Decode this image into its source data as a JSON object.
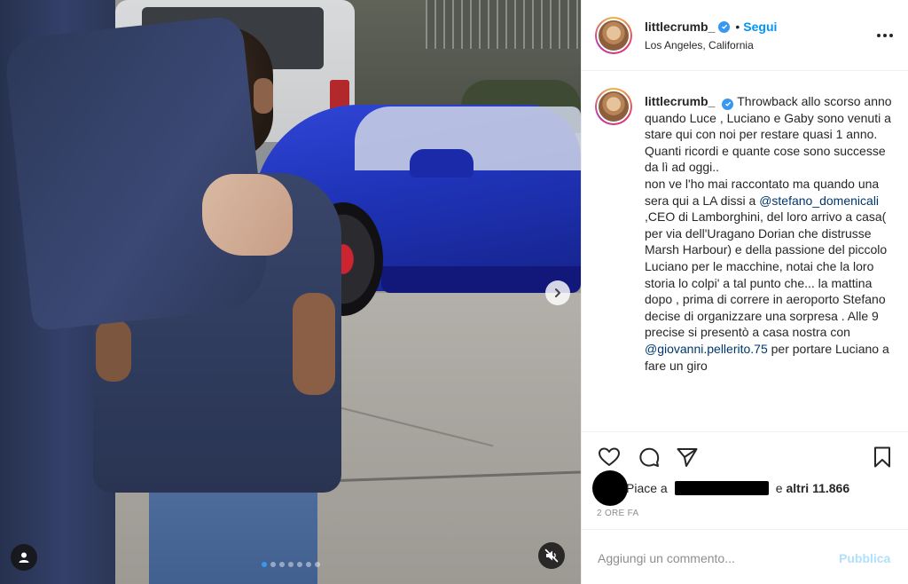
{
  "post": {
    "username": "littlecrumb_",
    "follow_label": "Segui",
    "separator": "•",
    "location": "Los Angeles, California",
    "caption": {
      "username": "littlecrumb_",
      "text_1": "Throwback allo scorso anno quando Luce , Luciano e Gaby sono venuti a stare qui con noi per restare quasi 1 anno. Quanti ricordi e quante cose sono successe da lì ad oggi..",
      "text_2": "non ve l'ho mai raccontato ma quando una sera qui a LA dissi a ",
      "mention_1": "@stefano_domenicali",
      "text_3": " ,CEO di Lamborghini, del loro arrivo a casa( per via dell'Uragano Dorian che distrusse Marsh Harbour) e della passione del piccolo Luciano per le macchine, notai che la loro storia lo colpi' a tal punto che... la mattina dopo , prima di correre in aeroporto Stefano decise di organizzare una sorpresa . Alle 9 precise si presentò a casa nostra con ",
      "mention_2": "@giovanni.pellerito.75",
      "text_4": " per portare Luciano a fare un giro"
    },
    "likes": {
      "prefix": "Piace a",
      "suffix": "e",
      "others": "altri 11.866"
    },
    "time_ago": "2 ORE FA",
    "comment": {
      "placeholder": "Aggiungi un commento...",
      "publish_label": "Pubblica"
    }
  },
  "carousel": {
    "dot_count": 7,
    "active_index": 0
  },
  "icons": [
    "verified-badge-icon",
    "more-options-icon",
    "heart-icon",
    "comment-icon",
    "share-icon",
    "bookmark-icon",
    "chevron-right-icon",
    "user-tag-icon",
    "muted-speaker-icon"
  ],
  "colors": {
    "accent": "#0095f6",
    "verified": "#3897f0",
    "mention": "#00376b",
    "publish_disabled": "#b2dffc",
    "meta_text": "#8e8e8e"
  }
}
